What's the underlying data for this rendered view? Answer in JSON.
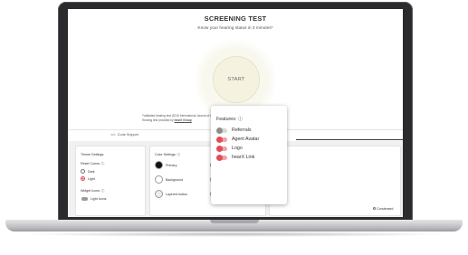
{
  "header": {
    "title": "SCREENING TEST",
    "subtitle": "Know your hearing status in 3 minutes*"
  },
  "start_button": {
    "label": "START"
  },
  "footnote": {
    "line1": "*Validated hearing test (2016 International Journal of Audiology; 2018 Ear and Hearing).",
    "line2_prefix": "Hearing test provided by ",
    "line2_link": "hearX Group"
  },
  "tabs": [
    {
      "label": "Code Snippet",
      "icon": "code-icon"
    },
    {
      "label": "Content",
      "icon": "document-icon"
    }
  ],
  "theme_settings": {
    "title": "Theme Settings:",
    "reset_colors_label": "Reset Colors: ⓘ",
    "options": [
      {
        "label": "Dark",
        "selected": false
      },
      {
        "label": "Light",
        "selected": true
      }
    ],
    "widget_icons_label": "Widget Icons: ⓘ",
    "widget_icons_value": "Light Icons"
  },
  "color_settings": {
    "title": "Color Settings: ⓘ",
    "swatches": [
      {
        "label": "Primary",
        "color": "#111111"
      },
      {
        "label": "Secondary",
        "color": "#d7ea85"
      },
      {
        "label": "Background",
        "color": "#ffffff"
      },
      {
        "label": "Text",
        "color": "#111111"
      },
      {
        "label": "Layered button",
        "color": "#ededed"
      },
      {
        "label": "Layered button text",
        "color": "#d7ea85"
      }
    ]
  },
  "features_panel_partial": {
    "title_fragment": "Fe",
    "right_fragment": "Condensed"
  },
  "features_popup": {
    "title": "Features: ⓘ",
    "items": [
      {
        "label": "Referrals",
        "enabled": false
      },
      {
        "label": "Agent Avatar",
        "enabled": true
      },
      {
        "label": "Logo",
        "enabled": true
      },
      {
        "label": "hearX Link",
        "enabled": true
      }
    ]
  },
  "colors": {
    "accent": "#e24c56",
    "start_bg": "#f5f3e0",
    "laptop_bezel": "#2b2b2e"
  }
}
